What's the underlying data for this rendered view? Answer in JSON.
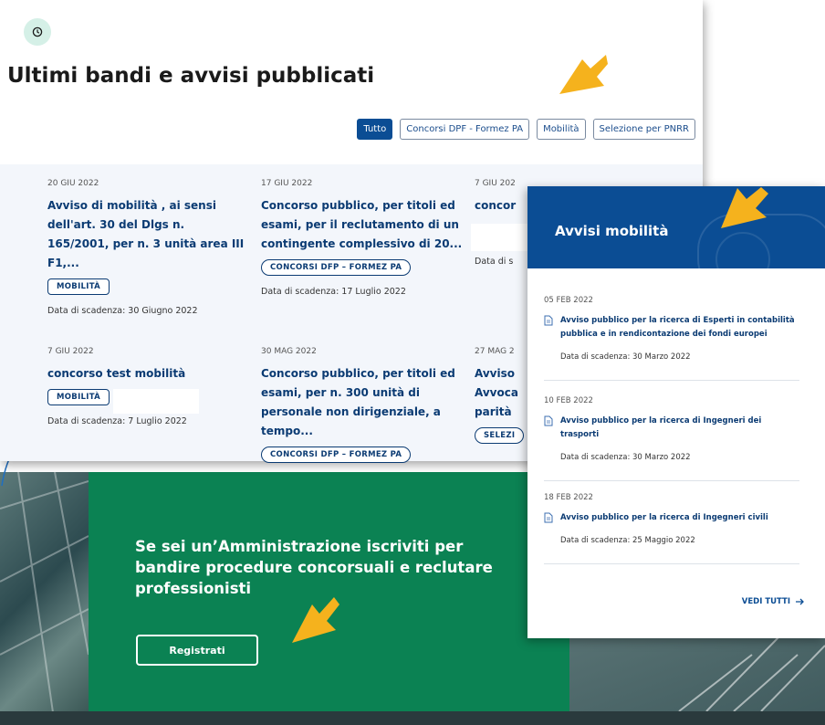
{
  "section": {
    "title": "Ultimi bandi e avvisi pubblicati"
  },
  "filters": [
    {
      "label": "Tutto",
      "active": true
    },
    {
      "label": "Concorsi DPF - Formez PA",
      "active": false
    },
    {
      "label": "Mobilità",
      "active": false
    },
    {
      "label": "Selezione per PNRR",
      "active": false
    }
  ],
  "cards": [
    {
      "date": "20 GIU 2022",
      "title": "Avviso di mobilità , ai sensi dell'art. 30 del Dlgs n. 165/2001, per n. 3 unità area III F1,...",
      "tag": "MOBILITÀ",
      "deadline": "Data di scadenza: 30 Giugno 2022"
    },
    {
      "date": "17 GIU 2022",
      "title": "Concorso pubblico, per titoli ed esami, per il reclutamento di un contingente complessivo di 20...",
      "tag": "CONCORSI DFP – FORMEZ PA",
      "deadline": "Data di scadenza: 17 Luglio 2022"
    },
    {
      "date": "7 GIU 202",
      "title": "concor",
      "deadline": "Data di s"
    },
    {
      "date": "7 GIU 2022",
      "title": "concorso test mobilità",
      "tag": "MOBILITÀ",
      "deadline": "Data di scadenza: 7 Luglio 2022"
    },
    {
      "date": "30 MAG 2022",
      "title": "Concorso pubblico, per titoli ed esami, per n. 300 unità di personale non dirigenziale, a tempo...",
      "tag": "CONCORSI DFP – FORMEZ PA"
    },
    {
      "date": "27 MAG 2",
      "title": "Avviso Avvoca parità",
      "tag": "SELEZI"
    }
  ],
  "mobility": {
    "title": "Avvisi mobilità",
    "items": [
      {
        "date": "05 FEB 2022",
        "link": "Avviso pubblico per la ricerca di Esperti in contabilità pubblica e in rendicontazione dei fondi europei",
        "deadline": "Data di scadenza: 30 Marzo 2022"
      },
      {
        "date": "10 FEB 2022",
        "link": "Avviso pubblico per la ricerca di Ingegneri dei trasporti",
        "deadline": "Data di scadenza: 30 Marzo 2022"
      },
      {
        "date": "18 FEB 2022",
        "link": "Avviso pubblico per la ricerca di Ingegneri civili",
        "deadline": "Data di scadenza: 25 Maggio 2022"
      }
    ],
    "see_all": "VEDI TUTTI"
  },
  "banner": {
    "text": "Se sei un’Amministrazione iscriviti per bandire procedure concorsuali e reclutare professionisti",
    "button": "Registrati"
  },
  "colors": {
    "primary_blue": "#0b4d94",
    "banner_green": "#0b8253",
    "arrow_yellow": "#f5b21d",
    "clock_badge": "#d5f0e7"
  },
  "icons": [
    "clock-icon",
    "document-icon",
    "arrow-right-icon",
    "pointer-arrow-icon"
  ]
}
